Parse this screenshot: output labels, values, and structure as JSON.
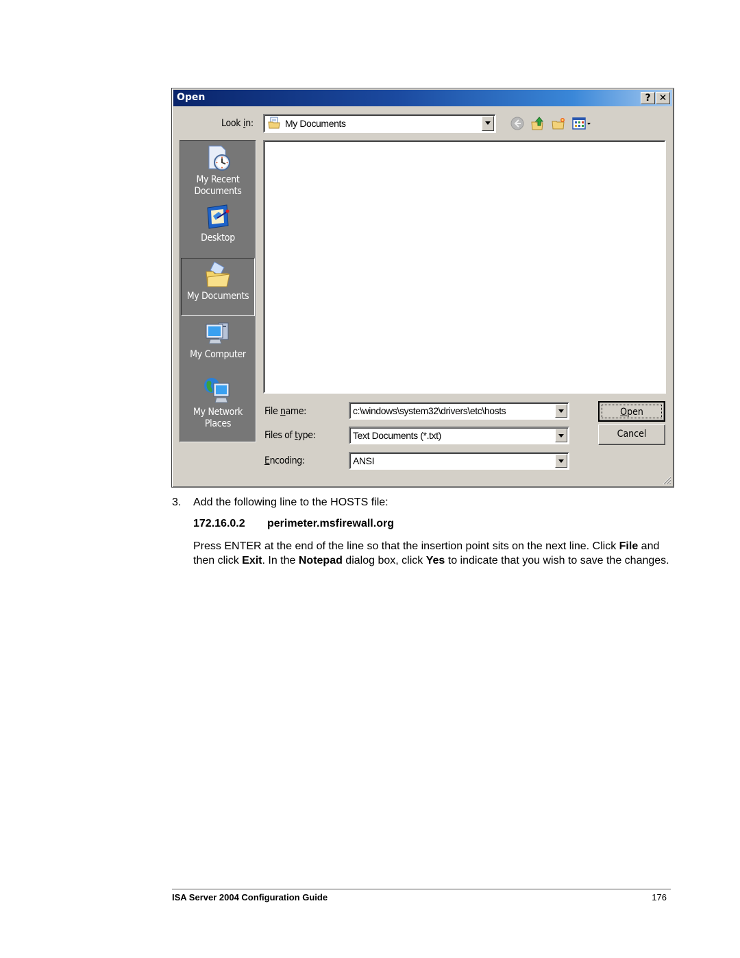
{
  "dialog": {
    "title": "Open",
    "title_buttons": {
      "help": "?",
      "close": "✕"
    },
    "look_in": {
      "label_pre": "Look ",
      "label_accel": "i",
      "label_post": "n:",
      "value": "My Documents",
      "icon": "my-documents-icon"
    },
    "toolbar": [
      {
        "name": "back-button",
        "icon": "back-arrow-icon",
        "enabled": false
      },
      {
        "name": "up-one-level-button",
        "icon": "folder-up-icon"
      },
      {
        "name": "new-folder-button",
        "icon": "new-folder-icon"
      },
      {
        "name": "view-menu-button",
        "icon": "view-menu-icon"
      }
    ],
    "places": [
      {
        "label_1": "My Recent",
        "label_2": "Documents",
        "icon": "recent-documents-icon"
      },
      {
        "label_1": "Desktop",
        "label_2": "",
        "icon": "desktop-icon"
      },
      {
        "label_1": "My Documents",
        "label_2": "",
        "icon": "my-documents-folder-icon",
        "selected": true
      },
      {
        "label_1": "My Computer",
        "label_2": "",
        "icon": "my-computer-icon"
      },
      {
        "label_1": "My Network",
        "label_2": "Places",
        "icon": "network-places-icon"
      }
    ],
    "file_name": {
      "label_pre": "File ",
      "label_accel": "n",
      "label_post": "ame:",
      "value": "c:\\windows\\system32\\drivers\\etc\\hosts"
    },
    "files_of_type": {
      "label_pre": "Files of ",
      "label_accel": "t",
      "label_post": "ype:",
      "value": "Text Documents (*.txt)"
    },
    "encoding": {
      "label_pre": "",
      "label_accel": "E",
      "label_post": "ncoding:",
      "value": "ANSI"
    },
    "open_button": {
      "accel": "O",
      "rest": "pen"
    },
    "cancel_button": "Cancel"
  },
  "document": {
    "step_number": "3.",
    "step_text": "Add the following line to the HOSTS file:",
    "hosts_ip": "172.16.0.2",
    "hosts_name": "perimeter.msfirewall.org",
    "paragraph": [
      {
        "text": "Press ENTER at the end of the line so that the insertion point sits on the next line. Click ",
        "bold": false
      },
      {
        "text": "File",
        "bold": true
      },
      {
        "text": " and then click ",
        "bold": false
      },
      {
        "text": "Exit",
        "bold": true
      },
      {
        "text": ". In the ",
        "bold": false
      },
      {
        "text": "Notepad",
        "bold": true
      },
      {
        "text": " dialog box, click ",
        "bold": false
      },
      {
        "text": "Yes",
        "bold": true
      },
      {
        "text": " to indicate that you wish to save the changes.",
        "bold": false
      }
    ]
  },
  "footer": {
    "title": "ISA Server 2004 Configuration Guide",
    "page_number": "176"
  }
}
